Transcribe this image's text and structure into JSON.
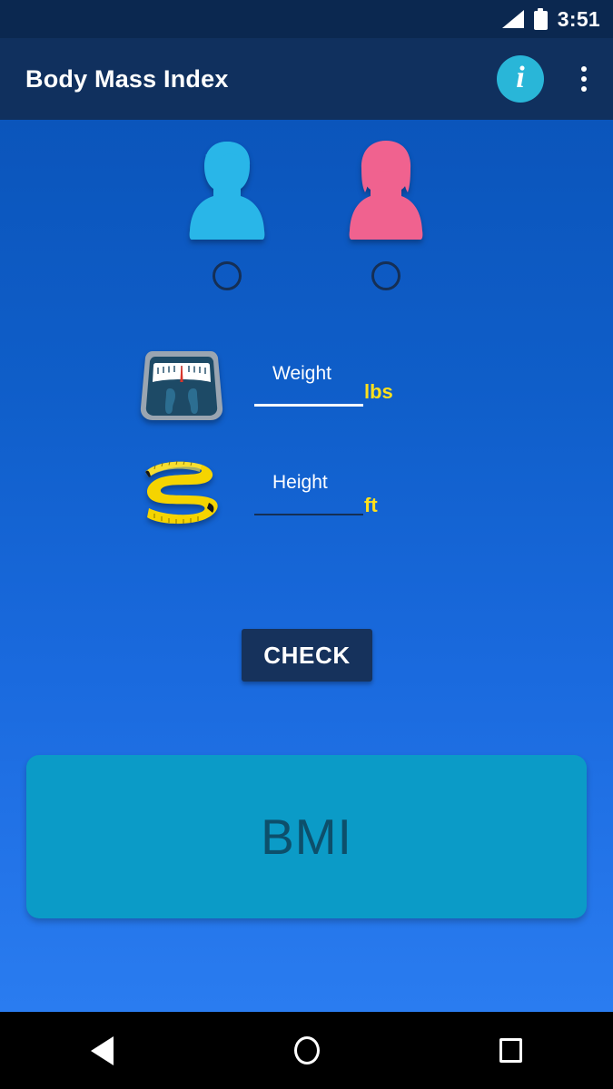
{
  "status_bar": {
    "time": "3:51",
    "signal_icon": "signal-bars-icon",
    "battery_icon": "battery-full-icon"
  },
  "app_bar": {
    "title": "Body Mass Index",
    "info_icon_label": "i",
    "info_icon_name": "info-icon",
    "overflow_icon_name": "overflow-menu-icon",
    "background_color": "#10305e"
  },
  "gender": {
    "options": [
      {
        "key": "male",
        "icon": "male-avatar-icon",
        "color": "#29b6e8",
        "selected": false
      },
      {
        "key": "female",
        "icon": "female-avatar-icon",
        "color": "#f0628f",
        "selected": false
      }
    ]
  },
  "weight": {
    "icon": "weighing-scale-icon",
    "label": "Weight",
    "value": "",
    "unit": "lbs",
    "focused": true
  },
  "height": {
    "icon": "measuring-tape-icon",
    "label": "Height",
    "value": "",
    "unit": "ft",
    "focused": false
  },
  "check_button": {
    "label": "CHECK",
    "background_color": "#16325c"
  },
  "result_card": {
    "text": "BMI",
    "background_color": "#0b9bc7",
    "text_color": "#0d4f6b"
  },
  "nav_bar": {
    "back_icon": "back-triangle-icon",
    "home_icon": "home-circle-icon",
    "recents_icon": "recents-square-icon"
  },
  "theme": {
    "accent_yellow": "#ffe01b",
    "background_top": "#0b55bb",
    "background_bottom": "#2a7cf0"
  }
}
